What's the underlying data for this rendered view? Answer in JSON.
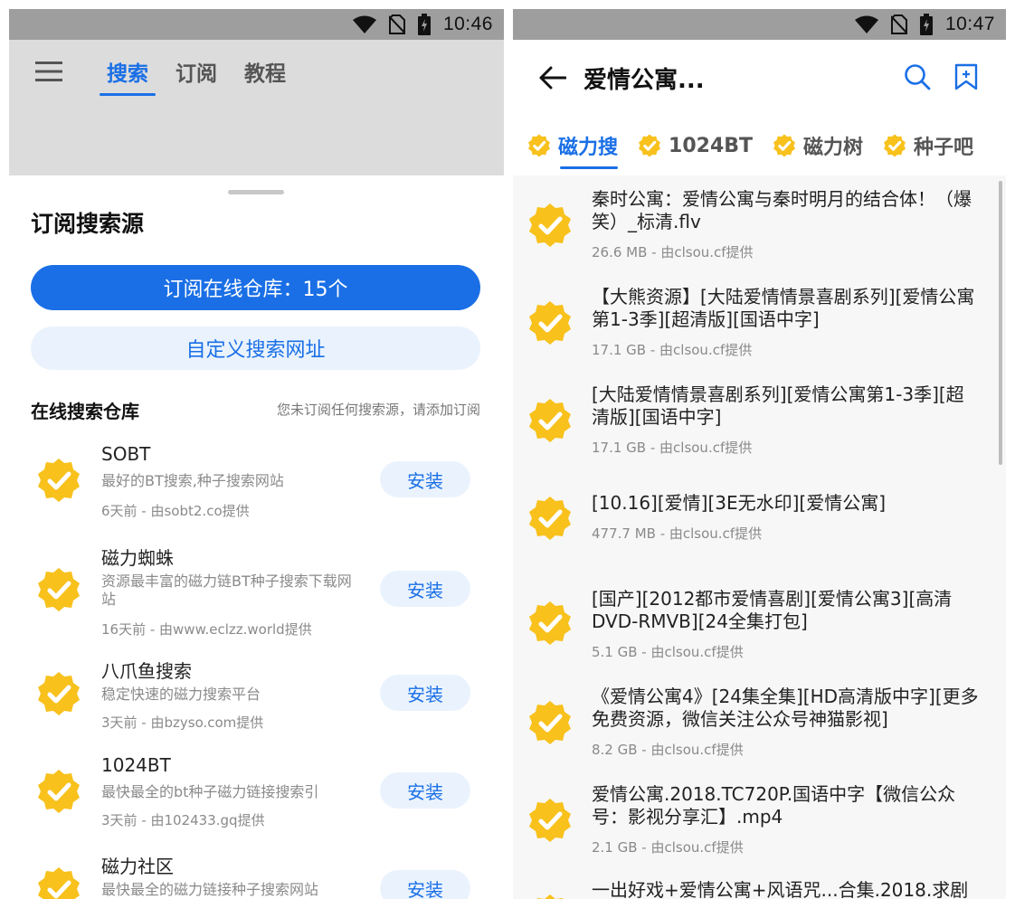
{
  "status_left": {
    "time": "10:46"
  },
  "status_right": {
    "time": "10:47"
  },
  "left": {
    "tabs": [
      {
        "label": "搜索",
        "active": true
      },
      {
        "label": "订阅",
        "active": false
      },
      {
        "label": "教程",
        "active": false
      }
    ],
    "sheet": {
      "title": "订阅搜索源",
      "primary_button": "订阅在线仓库：15个",
      "secondary_button": "自定义搜索网址",
      "section_title": "在线搜索仓库",
      "section_hint": "您未订阅任何搜索源，请添加订阅",
      "repos": [
        {
          "name": "SOBT",
          "desc": "最好的BT搜索,种子搜索网站",
          "meta": "6天前 - 由sobt2.co提供",
          "action": "安装"
        },
        {
          "name": "磁力蜘蛛",
          "desc": "资源最丰富的磁力链BT种子搜索下载网站",
          "meta": "16天前 - 由www.eclzz.world提供",
          "action": "安装"
        },
        {
          "name": "八爪鱼搜索",
          "desc": "稳定快速的磁力搜索平台",
          "meta": "3天前 - 由bzyso.com提供",
          "action": "安装"
        },
        {
          "name": "1024BT",
          "desc": "最快最全的bt种子磁力链接搜索引",
          "meta": "3天前 - 由102433.gq提供",
          "action": "安装"
        },
        {
          "name": "磁力社区",
          "desc": "最快最全的磁力链接种子搜索网站",
          "meta": "",
          "action": "安装"
        }
      ]
    }
  },
  "right": {
    "title": "爱情公寓...",
    "source_tabs": [
      {
        "label": "磁力搜",
        "active": true
      },
      {
        "label": "1024BT",
        "active": false
      },
      {
        "label": "磁力树",
        "active": false
      },
      {
        "label": "种子吧",
        "active": false
      }
    ],
    "results": [
      {
        "title": "秦时公寓：爱情公寓与秦时明月的结合体！（爆笑）_标清.flv",
        "meta": "26.6 MB - 由clsou.cf提供"
      },
      {
        "title": "【大熊资源】[大陆爱情情景喜剧系列][爱情公寓第1-3季][超清版][国语中字]",
        "meta": "17.1 GB - 由clsou.cf提供"
      },
      {
        "title": "[大陆爱情情景喜剧系列][爱情公寓第1-3季][超清版][国语中字]",
        "meta": "17.1 GB - 由clsou.cf提供"
      },
      {
        "title": "[10.16][爱情][3E无水印][爱情公寓]",
        "meta": "477.7 MB - 由clsou.cf提供"
      },
      {
        "title": "[国产][2012都市爱情喜剧][爱情公寓3][高清DVD-RMVB][24全集打包]",
        "meta": "5.1 GB - 由clsou.cf提供"
      },
      {
        "title": "《爱情公寓4》[24集全集][HD高清版中字][更多免费资源，微信关注公众号神猫影视]",
        "meta": "8.2 GB - 由clsou.cf提供"
      },
      {
        "title": "爱情公寓.2018.TC720P.国语中字【微信公众号：影视分享汇】.mp4",
        "meta": "2.1 GB - 由clsou.cf提供"
      },
      {
        "title": "一出好戏+爱情公寓+风语咒...合集.2018.求剧",
        "meta": ""
      }
    ]
  },
  "colors": {
    "accent": "#1a6fe6",
    "badge": "#f8c11c",
    "dim": "#dcdcdc",
    "statusbar": "#9e9e9e"
  }
}
